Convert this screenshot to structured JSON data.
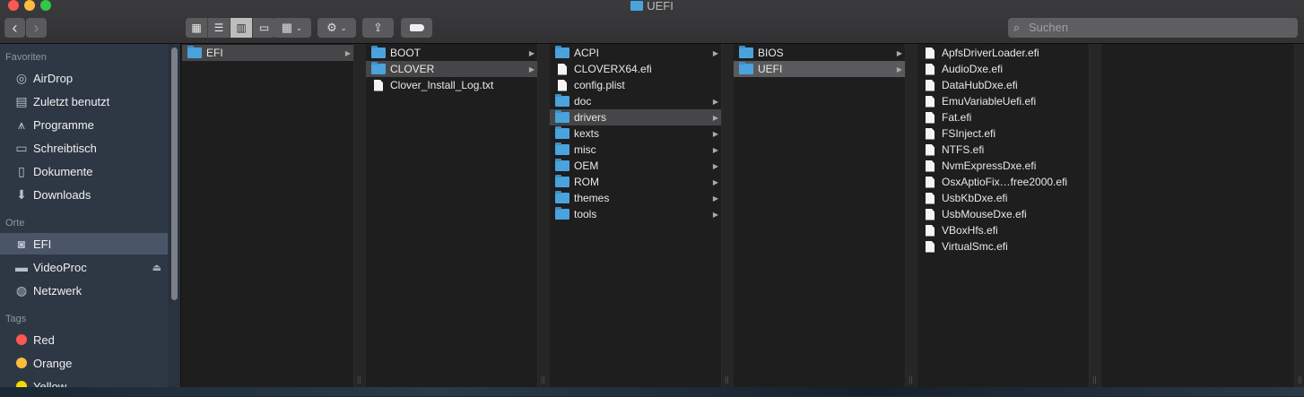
{
  "window": {
    "title": "UEFI"
  },
  "toolbar": {
    "back": "‹",
    "forward": "›",
    "views": [
      "icon-view",
      "list-view",
      "column-view",
      "gallery-view"
    ],
    "group": "group",
    "action": "action",
    "share": "share",
    "tags": "tags",
    "search_placeholder": "Suchen"
  },
  "sidebar": {
    "favorites_label": "Favoriten",
    "favorites": [
      {
        "label": "AirDrop",
        "icon": "airdrop-icon"
      },
      {
        "label": "Zuletzt benutzt",
        "icon": "recents-icon"
      },
      {
        "label": "Programme",
        "icon": "applications-icon"
      },
      {
        "label": "Schreibtisch",
        "icon": "desktop-icon"
      },
      {
        "label": "Dokumente",
        "icon": "documents-icon"
      },
      {
        "label": "Downloads",
        "icon": "downloads-icon"
      }
    ],
    "places_label": "Orte",
    "places": [
      {
        "label": "EFI",
        "icon": "disk-icon"
      },
      {
        "label": "VideoProc",
        "icon": "drive-icon"
      },
      {
        "label": "Netzwerk",
        "icon": "network-icon"
      }
    ],
    "tags_label": "Tags",
    "tags": [
      {
        "label": "Red",
        "color": "#fc5753"
      },
      {
        "label": "Orange",
        "color": "#fdbc40"
      },
      {
        "label": "Yellow",
        "color": "#f5d800"
      }
    ]
  },
  "columns": [
    [
      {
        "name": "EFI",
        "type": "folder",
        "state": "path"
      }
    ],
    [
      {
        "name": "BOOT",
        "type": "folder"
      },
      {
        "name": "CLOVER",
        "type": "folder",
        "state": "path"
      },
      {
        "name": "Clover_Install_Log.txt",
        "type": "file"
      }
    ],
    [
      {
        "name": "ACPI",
        "type": "folder"
      },
      {
        "name": "CLOVERX64.efi",
        "type": "file"
      },
      {
        "name": "config.plist",
        "type": "file"
      },
      {
        "name": "doc",
        "type": "folder"
      },
      {
        "name": "drivers",
        "type": "folder",
        "state": "path"
      },
      {
        "name": "kexts",
        "type": "folder"
      },
      {
        "name": "misc",
        "type": "folder"
      },
      {
        "name": "OEM",
        "type": "folder"
      },
      {
        "name": "ROM",
        "type": "folder"
      },
      {
        "name": "themes",
        "type": "folder"
      },
      {
        "name": "tools",
        "type": "folder"
      }
    ],
    [
      {
        "name": "BIOS",
        "type": "folder"
      },
      {
        "name": "UEFI",
        "type": "folder",
        "state": "sel"
      }
    ],
    [
      {
        "name": "ApfsDriverLoader.efi",
        "type": "file"
      },
      {
        "name": "AudioDxe.efi",
        "type": "file"
      },
      {
        "name": "DataHubDxe.efi",
        "type": "file"
      },
      {
        "name": "EmuVariableUefi.efi",
        "type": "file"
      },
      {
        "name": "Fat.efi",
        "type": "file"
      },
      {
        "name": "FSInject.efi",
        "type": "file"
      },
      {
        "name": "NTFS.efi",
        "type": "file"
      },
      {
        "name": "NvmExpressDxe.efi",
        "type": "file"
      },
      {
        "name": "OsxAptioFix…free2000.efi",
        "type": "file"
      },
      {
        "name": "UsbKbDxe.efi",
        "type": "file"
      },
      {
        "name": "UsbMouseDxe.efi",
        "type": "file"
      },
      {
        "name": "VBoxHfs.efi",
        "type": "file"
      },
      {
        "name": "VirtualSmc.efi",
        "type": "file"
      }
    ],
    []
  ]
}
